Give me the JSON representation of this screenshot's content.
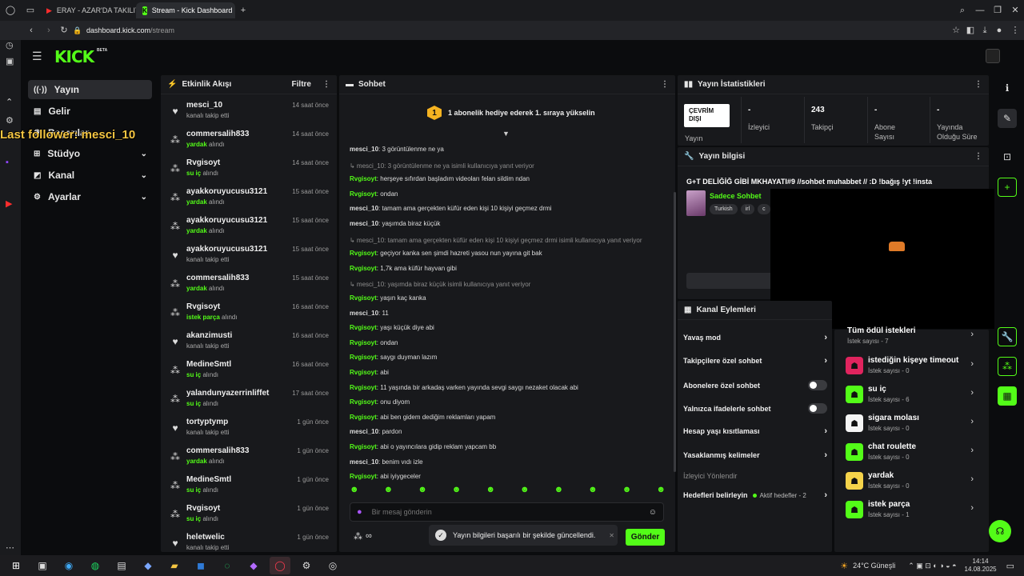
{
  "browser": {
    "tabs": [
      {
        "label": "ERAY - AZAR'DA TAKILIYO"
      },
      {
        "label": "Stream - Kick Dashboard"
      }
    ],
    "url_host": "dashboard.kick.com",
    "url_path": "/stream"
  },
  "header": {
    "logo": "KICK",
    "logo_badge": "BETA"
  },
  "overlay": {
    "last_follower": "Last follower: mesci_10"
  },
  "nav": {
    "items": [
      {
        "label": "Yayın"
      },
      {
        "label": "Gelir"
      },
      {
        "label": "Başarılar"
      },
      {
        "label": "Stüdyo"
      },
      {
        "label": "Kanal"
      },
      {
        "label": "Ayarlar"
      }
    ]
  },
  "activity": {
    "title": "Etkinlik Akışı",
    "filter": "Filtre",
    "items": [
      {
        "user": "mesci_10",
        "pre": "",
        "hl": "",
        "post": "kanalı takip etti",
        "time": "14 saat önce",
        "icon": "heart-icon"
      },
      {
        "user": "commersalih833",
        "pre": "",
        "hl": "yardak",
        "post": " alındı",
        "time": "14 saat önce",
        "icon": "redeem-icon"
      },
      {
        "user": "Rvgisoyt",
        "pre": "",
        "hl": "su iç",
        "post": " alındı",
        "time": "14 saat önce",
        "icon": "redeem-icon"
      },
      {
        "user": "ayakkoruyucusu3121",
        "pre": "",
        "hl": "yardak",
        "post": " alındı",
        "time": "15 saat önce",
        "icon": "redeem-icon"
      },
      {
        "user": "ayakkoruyucusu3121",
        "pre": "",
        "hl": "yardak",
        "post": " alındı",
        "time": "15 saat önce",
        "icon": "redeem-icon"
      },
      {
        "user": "ayakkoruyucusu3121",
        "pre": "",
        "hl": "",
        "post": "kanalı takip etti",
        "time": "15 saat önce",
        "icon": "heart-icon"
      },
      {
        "user": "commersalih833",
        "pre": "",
        "hl": "yardak",
        "post": " alındı",
        "time": "15 saat önce",
        "icon": "redeem-icon"
      },
      {
        "user": "Rvgisoyt",
        "pre": "",
        "hl": "istek parça",
        "post": " alındı",
        "time": "16 saat önce",
        "icon": "redeem-icon"
      },
      {
        "user": "akanzimusti",
        "pre": "",
        "hl": "",
        "post": "kanalı takip etti",
        "time": "16 saat önce",
        "icon": "heart-icon"
      },
      {
        "user": "MedineSmtl",
        "pre": "",
        "hl": "su iç",
        "post": " alındı",
        "time": "16 saat önce",
        "icon": "redeem-icon"
      },
      {
        "user": "yalandunyazerrinliffet",
        "pre": "",
        "hl": "su iç",
        "post": " alındı",
        "time": "17 saat önce",
        "icon": "redeem-icon"
      },
      {
        "user": "tortyptymp",
        "pre": "",
        "hl": "",
        "post": "kanalı takip etti",
        "time": "1 gün önce",
        "icon": "heart-icon"
      },
      {
        "user": "commersalih833",
        "pre": "",
        "hl": "yardak",
        "post": " alındı",
        "time": "1 gün önce",
        "icon": "redeem-icon"
      },
      {
        "user": "MedineSmtl",
        "pre": "",
        "hl": "su iç",
        "post": " alındı",
        "time": "1 gün önce",
        "icon": "redeem-icon"
      },
      {
        "user": "Rvgisoyt",
        "pre": "",
        "hl": "su iç",
        "post": " alındı",
        "time": "1 gün önce",
        "icon": "redeem-icon"
      },
      {
        "user": "heletwelic",
        "pre": "",
        "hl": "",
        "post": "kanalı takip etti",
        "time": "1 gün önce",
        "icon": "heart-icon"
      }
    ]
  },
  "chat": {
    "title": "Sohbet",
    "sub_banner": "1 abonelik hediye ederek 1. sıraya yükselin",
    "sub_badge": "1",
    "messages": [
      {
        "type": "msg",
        "user": "mesci_10",
        "color": "white",
        "text": ": 3 görüntülenme ne ya"
      },
      {
        "type": "reply",
        "text": "↳ mesci_10: 3 görüntülenme ne ya isimli kullanıcıya yanıt veriyor"
      },
      {
        "type": "msg",
        "user": "Rvgisoyt",
        "color": "green",
        "text": ": herşeye sıfırdan başladım videoları felan sildim ndan"
      },
      {
        "type": "msg",
        "user": "Rvgisoyt",
        "color": "green",
        "text": ": ondan"
      },
      {
        "type": "msg",
        "user": "mesci_10",
        "color": "white",
        "text": ": tamam ama gerçekten küfür eden kişi 10 kişiyi geçmez drmi"
      },
      {
        "type": "msg",
        "user": "mesci_10",
        "color": "white",
        "text": ": yaşımda biraz küçük"
      },
      {
        "type": "reply",
        "text": "↳ mesci_10: tamam ama gerçekten küfür eden kişi 10 kişiyi geçmez drmi isimli kullanıcıya yanıt veriyor"
      },
      {
        "type": "msg",
        "user": "Rvgisoyt",
        "color": "green",
        "text": ": geçiyor kanka sen şimdi hazreti yasou nun yayına git bak"
      },
      {
        "type": "msg",
        "user": "Rvgisoyt",
        "color": "green",
        "text": ": 1,7k ama küfür hayvan gibi"
      },
      {
        "type": "reply",
        "text": "↳ mesci_10: yaşımda biraz küçük isimli kullanıcıya yanıt veriyor"
      },
      {
        "type": "msg",
        "user": "Rvgisoyt",
        "color": "green",
        "text": ": yaşın kaç kanka"
      },
      {
        "type": "msg",
        "user": "mesci_10",
        "color": "white",
        "text": ": 11"
      },
      {
        "type": "msg",
        "user": "Rvgisoyt",
        "color": "green",
        "text": ": yaşı küçük diye abi"
      },
      {
        "type": "msg",
        "user": "Rvgisoyt",
        "color": "green",
        "text": ": ondan"
      },
      {
        "type": "msg",
        "user": "Rvgisoyt",
        "color": "green",
        "text": ": saygı duyman lazım"
      },
      {
        "type": "msg",
        "user": "Rvgisoyt",
        "color": "green",
        "text": ": abi"
      },
      {
        "type": "msg",
        "user": "Rvgisoyt",
        "color": "green",
        "text": ": 11 yaşında bir arkadaş varken yayında sevgi saygı nezaket olacak abi"
      },
      {
        "type": "msg",
        "user": "Rvgisoyt",
        "color": "green",
        "text": ": onu diyom"
      },
      {
        "type": "msg",
        "user": "Rvgisoyt",
        "color": "green",
        "text": ": abi ben gidem dediğim reklamları yapam"
      },
      {
        "type": "msg",
        "user": "mesci_10",
        "color": "white",
        "text": ": pardon"
      },
      {
        "type": "msg",
        "user": "Rvgisoyt",
        "color": "green",
        "text": ": abi o yayıncılara gidip reklam yapcam bb"
      },
      {
        "type": "msg",
        "user": "mesci_10",
        "color": "white",
        "text": ": benim vıdı izle"
      },
      {
        "type": "msg",
        "user": "Rvgisoyt",
        "color": "green",
        "text": ": abi iyiygeceler"
      }
    ],
    "input_placeholder": "Bir mesaj gönderin",
    "send_label": "Gönder",
    "points": "∞",
    "toast": "Yayın bilgileri başarılı bir şekilde güncellendi."
  },
  "stats": {
    "title": "Yayın İstatistikleri",
    "status_line1": "ÇEVRİM",
    "status_line2": "DIŞI",
    "status_label": "Yayın",
    "viewers_value": "-",
    "viewers_label": "İzleyici",
    "followers_value": "243",
    "followers_label": "Takipçi",
    "subs_value": "-",
    "subs_label1": "Abone",
    "subs_label2": "Sayısı",
    "uptime_value": "-",
    "uptime_label1": "Yayında",
    "uptime_label2": "Olduğu Süre"
  },
  "stream_info": {
    "title": "Yayın bilgisi",
    "stream_title": "G+T DELİĞİĞ GİBİ MKHAYATI#9 //sohbet muhabbet // :D !bağış !yt !insta",
    "category": "Sadece Sohbet",
    "tags": [
      "Turkish",
      "irl",
      "c"
    ]
  },
  "channel_actions": {
    "title": "Kanal Eylemleri",
    "items": [
      {
        "label": "Yavaş mod",
        "kind": "chevron"
      },
      {
        "label": "Takipçilere özel sohbet",
        "kind": "chevron"
      },
      {
        "label": "Abonelere özel sohbet",
        "kind": "toggle"
      },
      {
        "label": "Yalnızca ifadelerle sohbet",
        "kind": "toggle"
      },
      {
        "label": "Hesap yaşı kısıtlaması",
        "kind": "chevron"
      },
      {
        "label": "Yasaklanmış kelimeler",
        "kind": "chevron"
      }
    ],
    "section_label": "İzleyici Yönlendir",
    "goals_label": "Hedefleri belirleyin",
    "goals_status": "Aktif hedefler - 2"
  },
  "rewards": {
    "all_label": "Tüm ödül istekleri",
    "all_count": "İstek sayısı - 7",
    "items": [
      {
        "name": "istediğin kişeye timeout",
        "count": "İstek sayısı - 0",
        "color": "#e0245e"
      },
      {
        "name": "su iç",
        "count": "İstek sayısı - 6",
        "color": "#53fc18"
      },
      {
        "name": "sigara molası",
        "count": "İstek sayısı - 0",
        "color": "#f5f5f5"
      },
      {
        "name": "chat roulette",
        "count": "İstek sayısı - 0",
        "color": "#53fc18"
      },
      {
        "name": "yardak",
        "count": "İstek sayısı - 0",
        "color": "#f5d34a"
      },
      {
        "name": "istek parça",
        "count": "İstek sayısı - 1",
        "color": "#53fc18"
      }
    ]
  },
  "taskbar": {
    "weather": "24°C Güneşli",
    "time": "14:14",
    "date": "14.08.2025"
  }
}
